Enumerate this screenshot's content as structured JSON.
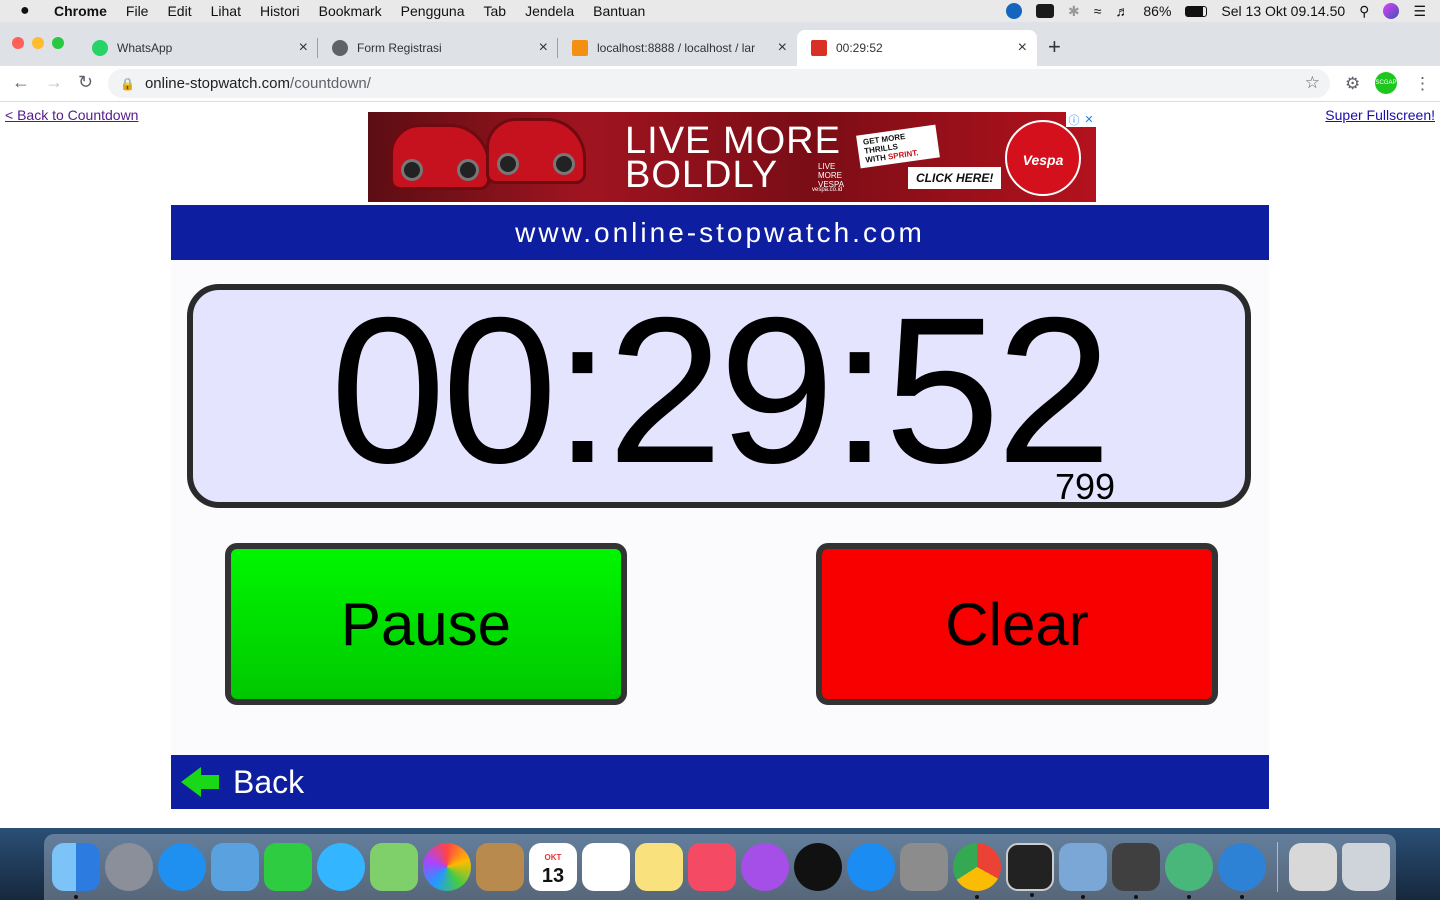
{
  "menubar": {
    "apple": "",
    "items": [
      "Chrome",
      "File",
      "Edit",
      "Lihat",
      "Histori",
      "Bookmark",
      "Pengguna",
      "Tab",
      "Jendela",
      "Bantuan"
    ],
    "battery": "86%",
    "clock": "Sel 13 Okt  09.14.50"
  },
  "tabs": [
    {
      "title": "WhatsApp",
      "color": "#25d366"
    },
    {
      "title": "Form Registrasi",
      "color": "#5f6368"
    },
    {
      "title": "localhost:8888 / localhost / lar",
      "color": "#f29111"
    },
    {
      "title": "00:29:52",
      "color": "#d93025"
    }
  ],
  "omnibox": {
    "host": "online-stopwatch.com",
    "path": "/countdown/"
  },
  "profile": "SCGAP",
  "page": {
    "back_link": "< Back to Countdown",
    "fullscreen_link": "Super Fullscreen!",
    "ad": {
      "headline_1": "LIVE MORE",
      "headline_2": "BOLDLY",
      "tagline": "LIVE MORE VESPA",
      "thrills_1": "GET MORE THRILLS",
      "thrills_2": "WITH",
      "thrills_3": "SPRINT.",
      "cta": "CLICK HERE!",
      "brand": "Vespa",
      "site": "vespa.co.id"
    },
    "banner": "www.online-stopwatch.com",
    "time": "00:29:52",
    "milliseconds": "799",
    "pause_label": "Pause",
    "clear_label": "Clear",
    "back_label": "Back"
  },
  "dock": {
    "calendar_month": "OKT",
    "calendar_day": "13",
    "apps": [
      {
        "name": "finder",
        "color": "#3d8fe8",
        "running": true
      },
      {
        "name": "launchpad",
        "color": "#8a8f99",
        "running": false
      },
      {
        "name": "safari",
        "color": "#1f8ff0",
        "running": false
      },
      {
        "name": "mail",
        "color": "#5aa1e0",
        "running": false
      },
      {
        "name": "facetime",
        "color": "#2ecc40",
        "running": false
      },
      {
        "name": "messages",
        "color": "#33b5ff",
        "running": false
      },
      {
        "name": "maps",
        "color": "#7fcf6a",
        "running": false
      },
      {
        "name": "photos",
        "color": "#f0f0f0",
        "running": false
      },
      {
        "name": "contacts",
        "color": "#b98a4e",
        "running": false
      },
      {
        "name": "calendar",
        "color": "#ffffff",
        "running": false
      },
      {
        "name": "reminders",
        "color": "#ffffff",
        "running": false
      },
      {
        "name": "notes",
        "color": "#f9e27d",
        "running": false
      },
      {
        "name": "music",
        "color": "#f54a64",
        "running": false
      },
      {
        "name": "podcasts",
        "color": "#a64ee8",
        "running": false
      },
      {
        "name": "tv",
        "color": "#111111",
        "running": false
      },
      {
        "name": "app-store",
        "color": "#1b8cf2",
        "running": false
      },
      {
        "name": "system-preferences",
        "color": "#8c8c8c",
        "running": false
      },
      {
        "name": "chrome",
        "color": "#ea4335",
        "running": true
      },
      {
        "name": "terminal",
        "color": "#222222",
        "running": true
      },
      {
        "name": "preview",
        "color": "#7aa7d6",
        "running": true
      },
      {
        "name": "sublime-text",
        "color": "#404040",
        "running": true
      },
      {
        "name": "atom",
        "color": "#49b77a",
        "running": true
      },
      {
        "name": "mamp",
        "color": "#2d82d6",
        "running": true
      }
    ]
  }
}
